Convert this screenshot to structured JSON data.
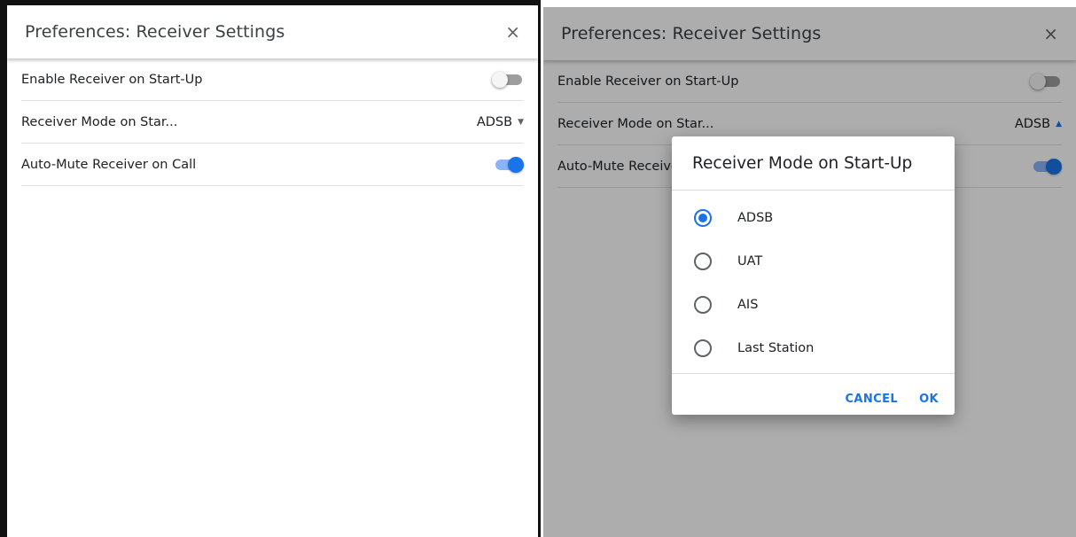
{
  "left": {
    "header": {
      "title": "Preferences: Receiver Settings",
      "close_glyph": "×"
    },
    "rows": [
      {
        "label": "Enable Receiver on Start-Up",
        "toggle": false
      },
      {
        "label": "Receiver Mode on Star...",
        "value": "ADSB",
        "caret": "▼"
      },
      {
        "label": "Auto-Mute Receiver on Call",
        "toggle": true
      }
    ]
  },
  "right": {
    "header": {
      "title": "Preferences: Receiver Settings",
      "close_glyph": "×"
    },
    "rows": [
      {
        "label": "Enable Receiver on Start-Up",
        "toggle": false
      },
      {
        "label": "Receiver Mode on Star...",
        "value": "ADSB",
        "caret": "▲"
      },
      {
        "label": "Auto-Mute Receiver on Call",
        "toggle": true
      }
    ],
    "dialog": {
      "title": "Receiver Mode on Start-Up",
      "options": [
        {
          "label": "ADSB",
          "selected": true
        },
        {
          "label": "UAT",
          "selected": false
        },
        {
          "label": "AIS",
          "selected": false
        },
        {
          "label": "Last Station",
          "selected": false
        }
      ],
      "cancel_label": "CANCEL",
      "ok_label": "OK"
    }
  },
  "colors": {
    "accent": "#1a73e8",
    "accent_light": "#8ab4f8",
    "scrim": "rgba(0,0,0,0.32)"
  },
  "icons": [
    "close-icon",
    "toggle-switch",
    "dropdown-caret-icon",
    "radio-button"
  ]
}
